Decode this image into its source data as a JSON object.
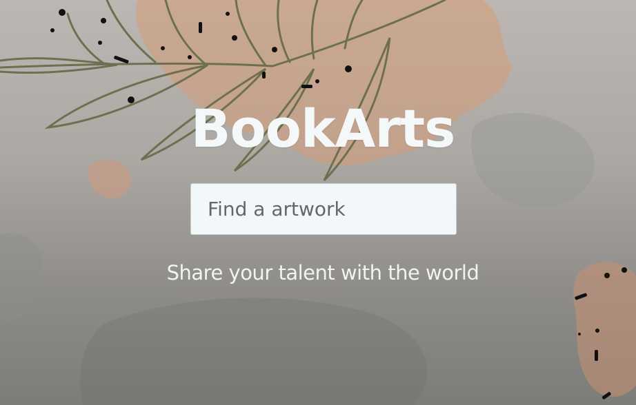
{
  "hero": {
    "title": "BookArts",
    "search": {
      "value": "",
      "placeholder": "Find a artwork"
    },
    "tagline": "Share your talent with the world"
  },
  "colors": {
    "background_top": "#bcb7b3",
    "background_bottom": "#7c7c78",
    "watercolor_peach": "#d39d7f",
    "leaf_stroke": "#6c7050",
    "title_text": "#f4f8f9",
    "input_background": "#f2f8f9"
  },
  "icons": {
    "background": "watercolor-leaf-illustration"
  }
}
